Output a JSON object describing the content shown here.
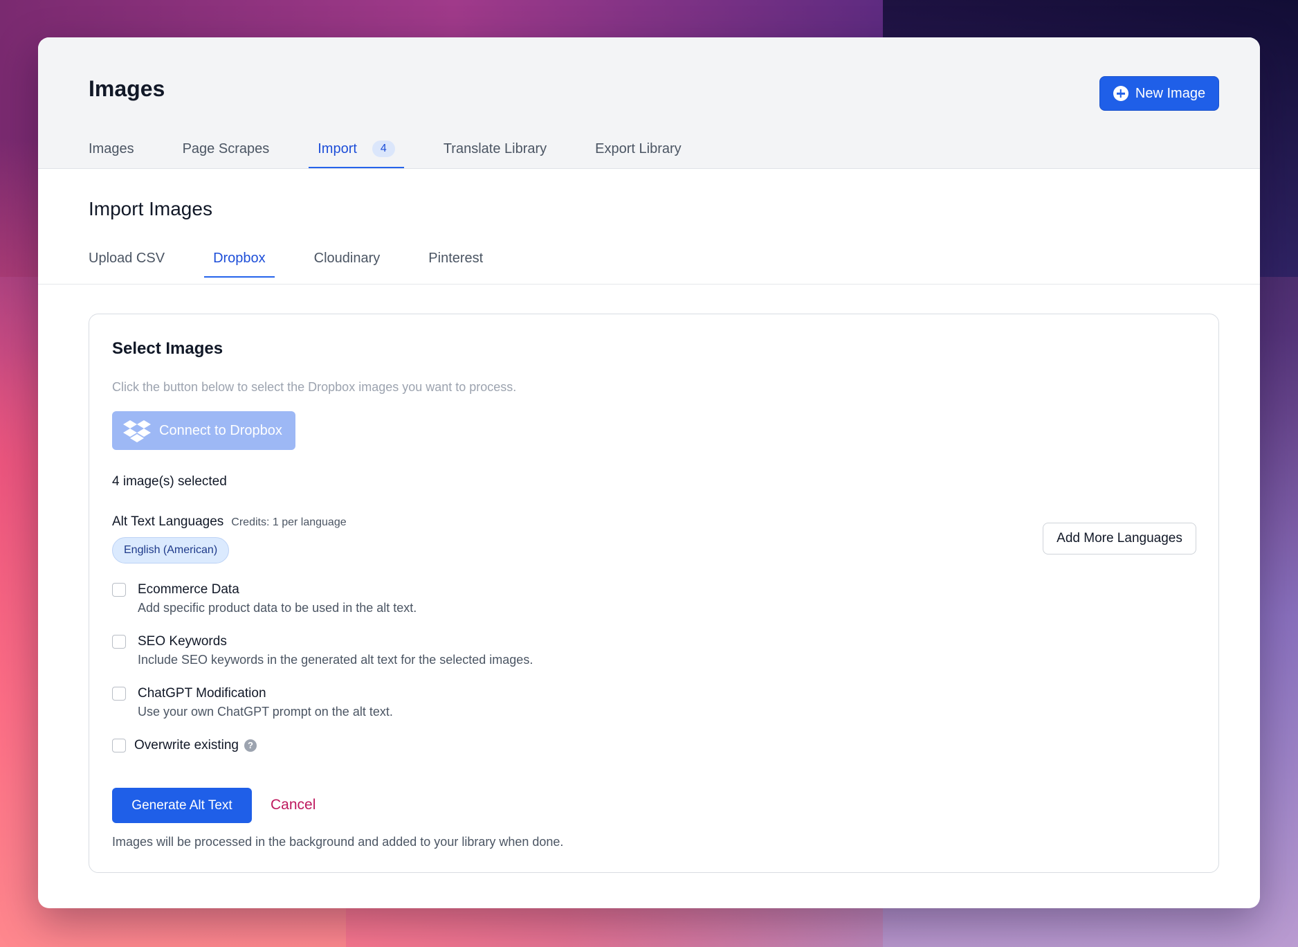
{
  "header": {
    "title": "Images",
    "new_button_label": "New Image",
    "tabs": [
      {
        "label": "Images"
      },
      {
        "label": "Page Scrapes"
      },
      {
        "label": "Import",
        "badge": "4"
      },
      {
        "label": "Translate Library"
      },
      {
        "label": "Export Library"
      }
    ]
  },
  "import_section": {
    "title": "Import Images",
    "tabs": [
      {
        "label": "Upload CSV"
      },
      {
        "label": "Dropbox"
      },
      {
        "label": "Cloudinary"
      },
      {
        "label": "Pinterest"
      }
    ]
  },
  "card": {
    "title": "Select Images",
    "description": "Click the button below to select the Dropbox images you want to process.",
    "connect_button_label": "Connect to Dropbox",
    "selected_count_text": "4 image(s) selected",
    "languages_label": "Alt Text Languages",
    "languages_credits": "Credits: 1 per language",
    "language_chip": "English (American)",
    "add_languages_label": "Add More Languages",
    "options": [
      {
        "title": "Ecommerce Data",
        "description": "Add specific product data to be used in the alt text.",
        "checked": false
      },
      {
        "title": "SEO Keywords",
        "description": "Include SEO keywords in the generated alt text for the selected images.",
        "checked": false
      },
      {
        "title": "ChatGPT Modification",
        "description": "Use your own ChatGPT prompt on the alt text.",
        "checked": false
      }
    ],
    "overwrite_label": "Overwrite existing",
    "help_glyph": "?",
    "generate_label": "Generate Alt Text",
    "cancel_label": "Cancel",
    "footer_note": "Images will be processed in the background and added to your library when done."
  },
  "colors": {
    "primary": "#1f5fe8",
    "active_tab": "#1d4ed8",
    "cancel": "#be185d",
    "dropbox_button": "#9db8f5"
  }
}
